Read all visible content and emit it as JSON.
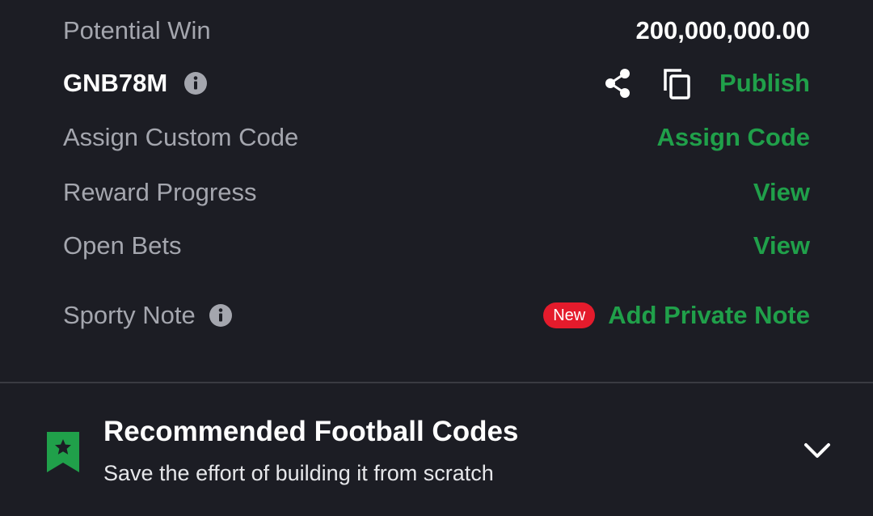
{
  "summary": {
    "potential_win_label": "Potential Win",
    "potential_win_value": "200,000,000.00"
  },
  "booking": {
    "code": "GNB78M",
    "publish_label": "Publish"
  },
  "custom_code": {
    "label": "Assign Custom Code",
    "action": "Assign Code"
  },
  "reward_progress": {
    "label": "Reward Progress",
    "action": "View"
  },
  "open_bets": {
    "label": "Open Bets",
    "action": "View"
  },
  "sporty_note": {
    "label": "Sporty Note",
    "badge": "New",
    "action": "Add Private Note"
  },
  "recommended": {
    "title": "Recommended Football Codes",
    "subtitle": "Save the effort of building it from scratch"
  },
  "colors": {
    "accent_green": "#20a04a",
    "badge_red": "#e41b2c",
    "background": "#1c1d24",
    "muted_text": "#a4a6ae"
  }
}
